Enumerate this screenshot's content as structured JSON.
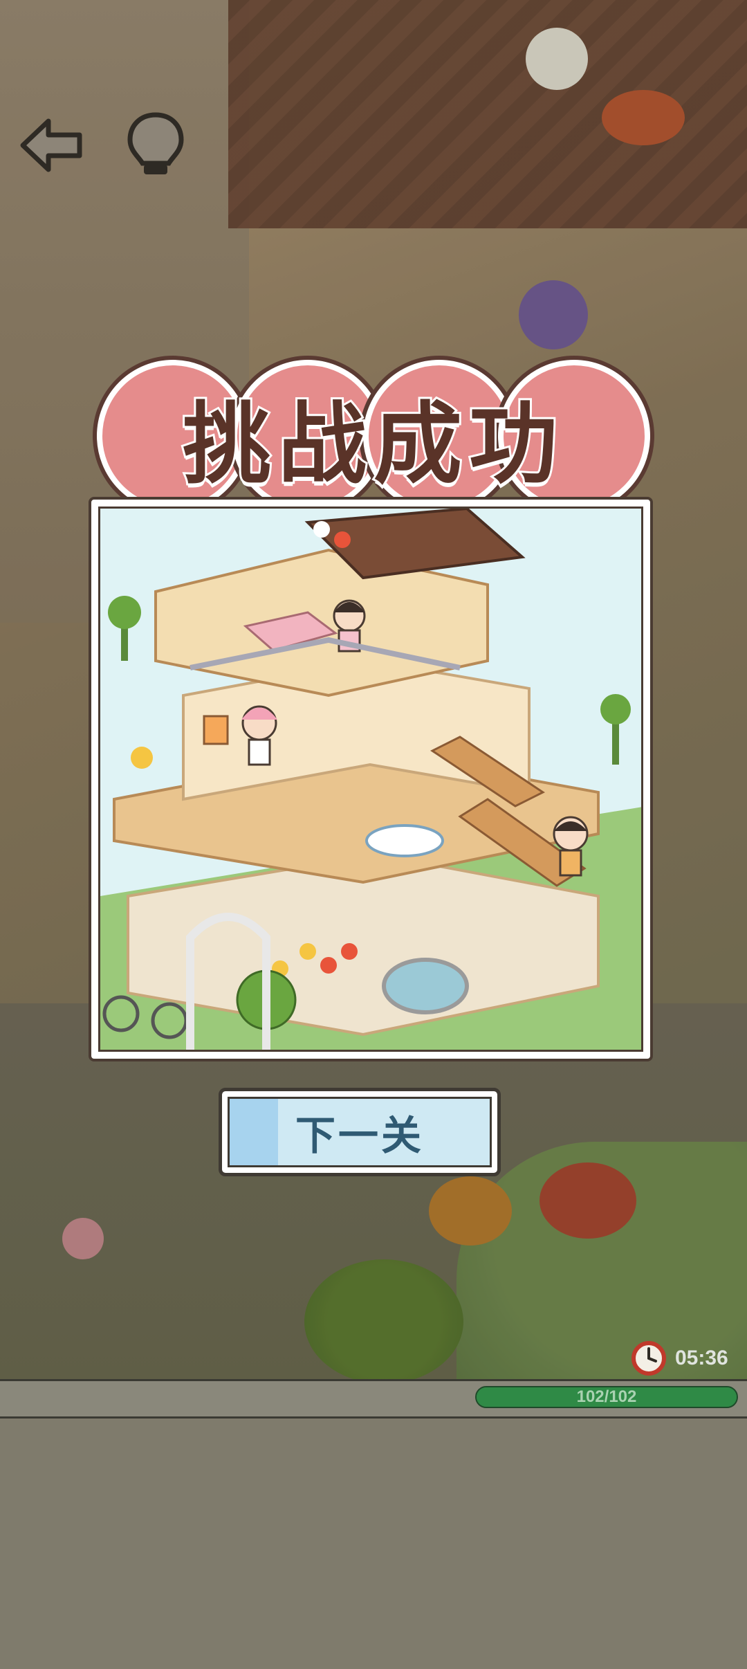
{
  "title": "挑战成功",
  "next_button_label": "下一关",
  "timer": {
    "time": "05:36",
    "icon": "clock-icon"
  },
  "progress": {
    "text": "102/102",
    "current": 102,
    "total": 102,
    "fraction": 1.0
  },
  "hud": {
    "back_icon": "back-arrow-icon",
    "hint_icon": "lightbulb-icon"
  },
  "colors": {
    "title_bubble": "#e58c8c",
    "title_text": "#5a3328",
    "button_bg": "#cfe9f3",
    "button_text": "#2f5a73",
    "progress_fill": "#2f8a46",
    "timer_icon": "#c0392b"
  }
}
